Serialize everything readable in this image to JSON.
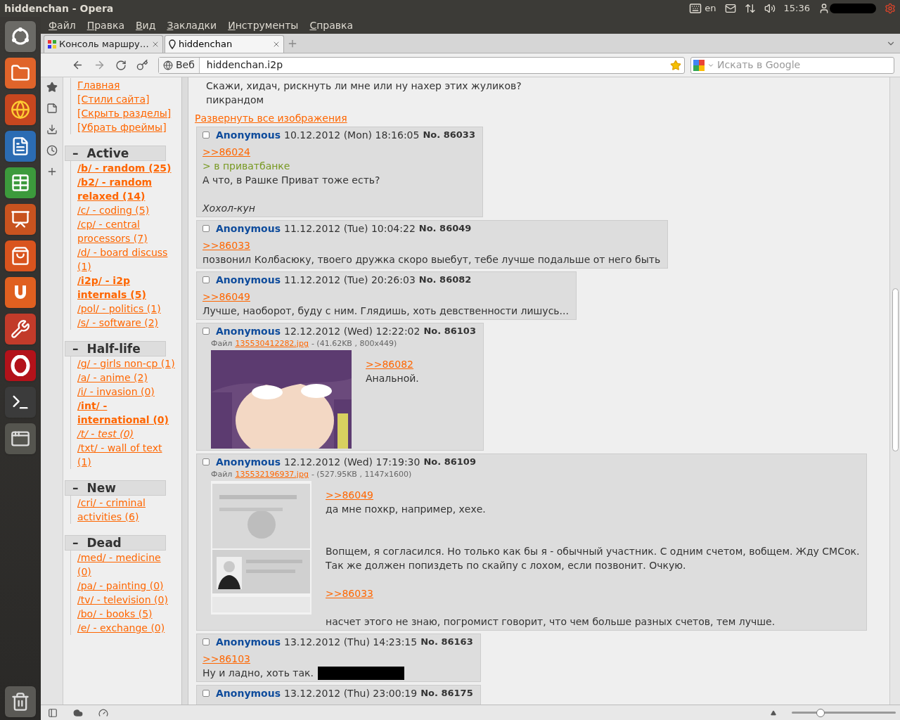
{
  "top_panel": {
    "title": "hiddenchan - Opera",
    "keyboard_layout": "en",
    "time": "15:36"
  },
  "menu": [
    "Файл",
    "Правка",
    "Вид",
    "Закладки",
    "Инструменты",
    "Справка"
  ],
  "tabs": [
    {
      "label": "Консоль маршру…",
      "selected": false
    },
    {
      "label": "hiddenchan",
      "selected": true
    }
  ],
  "address_bar": {
    "scheme_label": "Веб",
    "url": "hiddenchan.i2p",
    "search_placeholder": "Искать в Google"
  },
  "sidebar": {
    "links": [
      "Главная",
      "[Стили сайта]",
      "[Скрыть разделы]",
      "[Убрать фреймы]"
    ],
    "sections": [
      {
        "toggle": "–",
        "title": "Active",
        "boards": [
          {
            "label": "/b/ - random (25)",
            "bold": true,
            "italic": false
          },
          {
            "label": "/b2/ - random relaxed (14)",
            "bold": true,
            "italic": false
          },
          {
            "label": "/c/ - coding (5)",
            "bold": false,
            "italic": false
          },
          {
            "label": "/cp/ - central processors (7)",
            "bold": false,
            "italic": false
          },
          {
            "label": "/d/ - board discuss (1)",
            "bold": false,
            "italic": false
          },
          {
            "label": "/i2p/ - i2p internals (5)",
            "bold": true,
            "italic": false
          },
          {
            "label": "/pol/ - politics (1)",
            "bold": false,
            "italic": false
          },
          {
            "label": "/s/ - software (2)",
            "bold": false,
            "italic": false
          }
        ]
      },
      {
        "toggle": "–",
        "title": "Half-life",
        "boards": [
          {
            "label": "/g/ - girls non-cp (1)",
            "bold": false,
            "italic": false
          },
          {
            "label": "/a/ - anime (2)",
            "bold": false,
            "italic": false
          },
          {
            "label": "/i/ - invasion (0)",
            "bold": false,
            "italic": false
          },
          {
            "label": "/int/ - international (0)",
            "bold": true,
            "italic": false
          },
          {
            "label": "/t/ - test (0)",
            "bold": false,
            "italic": true
          },
          {
            "label": "/txt/ - wall of text (1)",
            "bold": false,
            "italic": false
          }
        ]
      },
      {
        "toggle": "–",
        "title": "New",
        "boards": [
          {
            "label": "/cri/ - criminal activities (6)",
            "bold": false,
            "italic": false
          }
        ]
      },
      {
        "toggle": "–",
        "title": "Dead",
        "boards": [
          {
            "label": "/med/ - medicine (0)",
            "bold": false,
            "italic": false
          },
          {
            "label": "/pa/ - painting (0)",
            "bold": false,
            "italic": false
          },
          {
            "label": "/tv/ - television (0)",
            "bold": false,
            "italic": false
          },
          {
            "label": "/bo/ - books (5)",
            "bold": false,
            "italic": false
          },
          {
            "label": "/e/ - exchange (0)",
            "bold": false,
            "italic": false
          }
        ]
      }
    ]
  },
  "thread": {
    "op_lines": [
      "Скажи, хидач, рискнуть ли мне или ну нахер этих жуликов?",
      "пикрандом"
    ],
    "expand_link": "Развернуть все изображения",
    "posts": [
      {
        "checked": false,
        "name": "Anonymous",
        "date": "10.12.2012 (Mon) 18:16:05",
        "number": "No. 86033",
        "body": [
          {
            "kind": "ref",
            "text": ">>86024"
          },
          {
            "kind": "quote",
            "text": "> в приватбанке"
          },
          {
            "kind": "text",
            "text": "А что, в Рашке Приват тоже есть?"
          },
          {
            "kind": "blank"
          },
          {
            "kind": "italic",
            "text": "Хохол-кун"
          }
        ]
      },
      {
        "checked": false,
        "name": "Anonymous",
        "date": "11.12.2012 (Tue) 10:04:22",
        "number": "No. 86049",
        "body": [
          {
            "kind": "ref",
            "text": ">>86033"
          },
          {
            "kind": "text",
            "text": "позвонил Колбасюку, твоего дружка скоро выебут, тебе лучше подальше от него быть"
          }
        ]
      },
      {
        "checked": false,
        "name": "Anonymous",
        "date": "11.12.2012 (Tue) 20:26:03",
        "number": "No. 86082",
        "body": [
          {
            "kind": "ref",
            "text": ">>86049"
          },
          {
            "kind": "text",
            "text": "Лучше, наоборот, буду с ним. Глядишь, хоть девственности лишусь..."
          }
        ]
      },
      {
        "checked": false,
        "name": "Anonymous",
        "date": "12.12.2012 (Wed) 12:22:02",
        "number": "No. 86103",
        "file": {
          "label": "Файл",
          "name": "135530412282.jpg",
          "info": "- (41.62KB , 800x449)",
          "kind": "cartoon"
        },
        "body": [
          {
            "kind": "ref",
            "text": ">>86082"
          },
          {
            "kind": "text",
            "text": "Анальной."
          }
        ]
      },
      {
        "checked": false,
        "name": "Anonymous",
        "date": "12.12.2012 (Wed) 17:19:30",
        "number": "No. 86109",
        "file": {
          "label": "Файл",
          "name": "135532196937.jpg",
          "info": "- (527.95KB , 1147x1600)",
          "kind": "document"
        },
        "body": [
          {
            "kind": "ref",
            "text": ">>86049"
          },
          {
            "kind": "text",
            "text": "да мне похкр, например, хехе."
          },
          {
            "kind": "blank"
          },
          {
            "kind": "blank"
          },
          {
            "kind": "text",
            "text": "Вопщем, я согласился. Но только как бы я - обычный участник. С одним счетом, вобщем. Жду СМСок."
          },
          {
            "kind": "text",
            "text": "Так же должен попиздеть по скайпу с лохом, если позвонит. Очкую."
          },
          {
            "kind": "blank"
          },
          {
            "kind": "ref",
            "text": ">>86033"
          },
          {
            "kind": "blank"
          },
          {
            "kind": "text",
            "text": "насчет этого не знаю, погромист говорит, что чем больше разных счетов, тем лучше."
          }
        ]
      },
      {
        "checked": false,
        "name": "Anonymous",
        "date": "13.12.2012 (Thu) 14:23:15",
        "number": "No. 86163",
        "body": [
          {
            "kind": "ref",
            "text": ">>86103"
          },
          {
            "kind": "text",
            "text": "Ну и ладно, хоть так.",
            "redacted": true
          }
        ]
      },
      {
        "checked": false,
        "name": "Anonymous",
        "date": "13.12.2012 (Thu) 23:00:19",
        "number": "No. 86175"
      }
    ]
  },
  "status_bar": {
    "zoom": {
      "level": 0.28
    }
  }
}
